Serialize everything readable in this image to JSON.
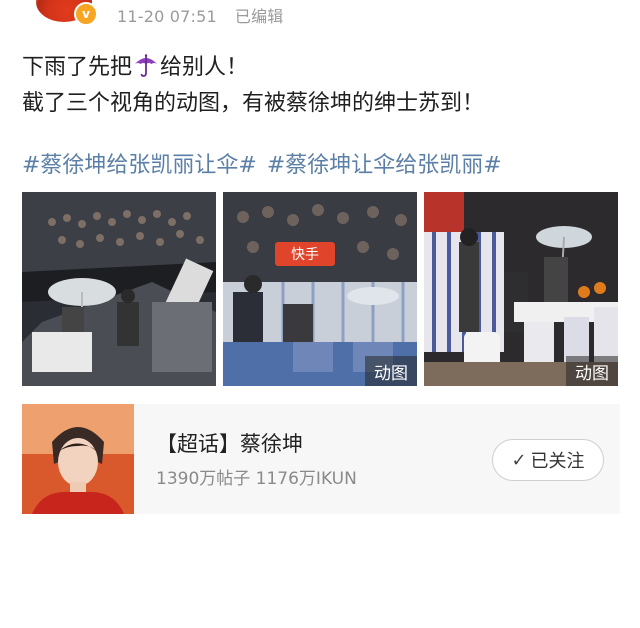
{
  "post": {
    "time": "11-20 07:51",
    "edited": "已编辑",
    "vip_badge": "v",
    "line1_before": "下雨了先把",
    "line1_after": "给别人！",
    "line2": "截了三个视角的动图，有被蔡徐坤的绅士苏到！",
    "umbrella_icon": "umbrella-icon",
    "hashtags": [
      "#蔡徐坤给张凯丽让伞#",
      "#蔡徐坤让伞给张凯丽#"
    ],
    "hashtag_color": "#5b7fa6"
  },
  "media": {
    "gif_badges": [
      "动图",
      "动图"
    ],
    "sign_text": "快手"
  },
  "topic": {
    "title": "【超话】蔡徐坤",
    "stats": "1390万帖子 1176万IKUN",
    "follow_label": "已关注"
  }
}
